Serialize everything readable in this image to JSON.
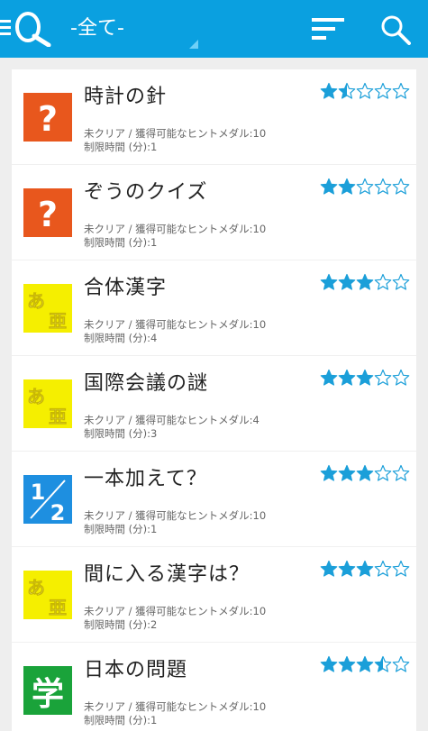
{
  "header": {
    "filter_label": "-全て-",
    "icons": [
      "menu-icon",
      "quiz-logo-icon",
      "sort-icon",
      "search-icon"
    ]
  },
  "colors": {
    "appbar": "#0aa0e0",
    "star": "#1b9fd9",
    "orange": "#e8571d",
    "yellow": "#f5ef00",
    "blue": "#1e8fe0",
    "green": "#1aa33a"
  },
  "puzzles": [
    {
      "title": "時計の針",
      "status": "未クリア / 獲得可能なヒントメダル:10",
      "time": "制限時間 (分):1",
      "rating": 1.5,
      "icon": "question-icon",
      "color": "#e8571d"
    },
    {
      "title": "ぞうのクイズ",
      "status": "未クリア / 獲得可能なヒントメダル:10",
      "time": "制限時間 (分):1",
      "rating": 2,
      "icon": "question-icon",
      "color": "#e8571d"
    },
    {
      "title": "合体漢字",
      "status": "未クリア / 獲得可能なヒントメダル:10",
      "time": "制限時間 (分):4",
      "rating": 3,
      "icon": "kanji-icon",
      "color": "#f5ef00"
    },
    {
      "title": "国際会議の謎",
      "status": "未クリア / 獲得可能なヒントメダル:4",
      "time": "制限時間 (分):3",
      "rating": 3,
      "icon": "kanji-icon",
      "color": "#f5ef00"
    },
    {
      "title": "一本加えて？",
      "status": "未クリア / 獲得可能なヒントメダル:10",
      "time": "制限時間 (分):1",
      "rating": 3,
      "icon": "numbers-icon",
      "color": "#1e8fe0"
    },
    {
      "title": "間に入る漢字は？",
      "status": "未クリア / 獲得可能なヒントメダル:10",
      "time": "制限時間 (分):2",
      "rating": 3,
      "icon": "kanji-icon",
      "color": "#f5ef00"
    },
    {
      "title": "日本の問題",
      "status": "未クリア / 獲得可能なヒントメダル:10",
      "time": "制限時間 (分):1",
      "rating": 3.5,
      "icon": "gaku-icon",
      "color": "#1aa33a"
    }
  ]
}
